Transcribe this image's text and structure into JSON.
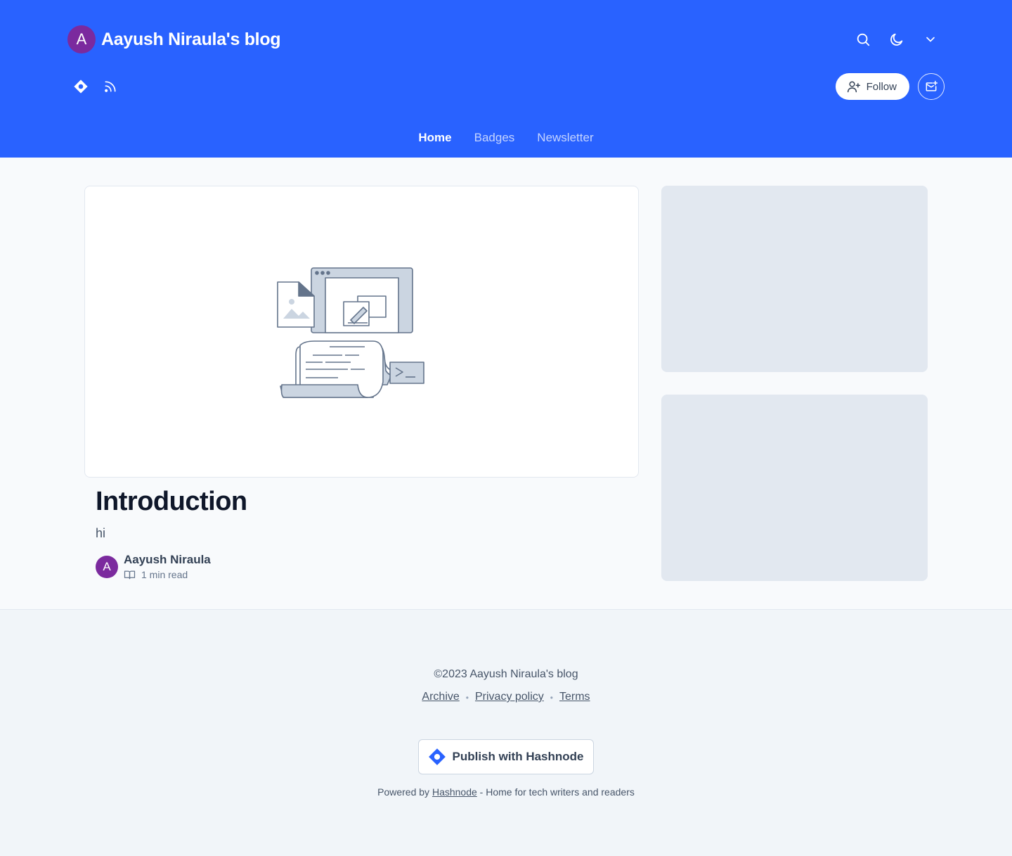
{
  "header": {
    "avatar_letter": "A",
    "blog_title": "Aayush Niraula's blog",
    "follow_label": "Follow",
    "nav": [
      {
        "label": "Home",
        "active": true
      },
      {
        "label": "Badges",
        "active": false
      },
      {
        "label": "Newsletter",
        "active": false
      }
    ],
    "brand_color": "#2962ff",
    "avatar_color": "#7b2a9e"
  },
  "post": {
    "title": "Introduction",
    "excerpt": "hi",
    "author_letter": "A",
    "author_name": "Aayush Niraula",
    "read_time": "1 min read"
  },
  "footer": {
    "copyright": "©2023 Aayush Niraula's blog",
    "links": [
      "Archive",
      "Privacy policy",
      "Terms"
    ],
    "publish_label": "Publish with Hashnode",
    "powered_prefix": "Powered by",
    "powered_link": "Hashnode",
    "powered_suffix": "- Home for tech writers and readers"
  }
}
